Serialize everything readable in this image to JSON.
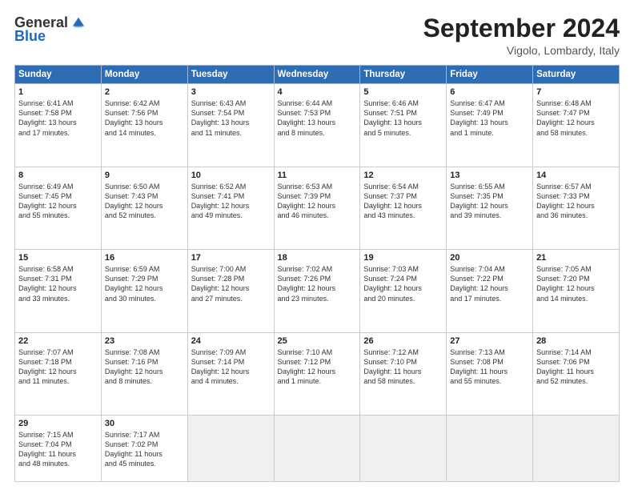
{
  "logo": {
    "general": "General",
    "blue": "Blue"
  },
  "title": "September 2024",
  "location": "Vigolo, Lombardy, Italy",
  "days_of_week": [
    "Sunday",
    "Monday",
    "Tuesday",
    "Wednesday",
    "Thursday",
    "Friday",
    "Saturday"
  ],
  "weeks": [
    [
      {
        "day": "1",
        "text": "Sunrise: 6:41 AM\nSunset: 7:58 PM\nDaylight: 13 hours\nand 17 minutes."
      },
      {
        "day": "2",
        "text": "Sunrise: 6:42 AM\nSunset: 7:56 PM\nDaylight: 13 hours\nand 14 minutes."
      },
      {
        "day": "3",
        "text": "Sunrise: 6:43 AM\nSunset: 7:54 PM\nDaylight: 13 hours\nand 11 minutes."
      },
      {
        "day": "4",
        "text": "Sunrise: 6:44 AM\nSunset: 7:53 PM\nDaylight: 13 hours\nand 8 minutes."
      },
      {
        "day": "5",
        "text": "Sunrise: 6:46 AM\nSunset: 7:51 PM\nDaylight: 13 hours\nand 5 minutes."
      },
      {
        "day": "6",
        "text": "Sunrise: 6:47 AM\nSunset: 7:49 PM\nDaylight: 13 hours\nand 1 minute."
      },
      {
        "day": "7",
        "text": "Sunrise: 6:48 AM\nSunset: 7:47 PM\nDaylight: 12 hours\nand 58 minutes."
      }
    ],
    [
      {
        "day": "8",
        "text": "Sunrise: 6:49 AM\nSunset: 7:45 PM\nDaylight: 12 hours\nand 55 minutes."
      },
      {
        "day": "9",
        "text": "Sunrise: 6:50 AM\nSunset: 7:43 PM\nDaylight: 12 hours\nand 52 minutes."
      },
      {
        "day": "10",
        "text": "Sunrise: 6:52 AM\nSunset: 7:41 PM\nDaylight: 12 hours\nand 49 minutes."
      },
      {
        "day": "11",
        "text": "Sunrise: 6:53 AM\nSunset: 7:39 PM\nDaylight: 12 hours\nand 46 minutes."
      },
      {
        "day": "12",
        "text": "Sunrise: 6:54 AM\nSunset: 7:37 PM\nDaylight: 12 hours\nand 43 minutes."
      },
      {
        "day": "13",
        "text": "Sunrise: 6:55 AM\nSunset: 7:35 PM\nDaylight: 12 hours\nand 39 minutes."
      },
      {
        "day": "14",
        "text": "Sunrise: 6:57 AM\nSunset: 7:33 PM\nDaylight: 12 hours\nand 36 minutes."
      }
    ],
    [
      {
        "day": "15",
        "text": "Sunrise: 6:58 AM\nSunset: 7:31 PM\nDaylight: 12 hours\nand 33 minutes."
      },
      {
        "day": "16",
        "text": "Sunrise: 6:59 AM\nSunset: 7:29 PM\nDaylight: 12 hours\nand 30 minutes."
      },
      {
        "day": "17",
        "text": "Sunrise: 7:00 AM\nSunset: 7:28 PM\nDaylight: 12 hours\nand 27 minutes."
      },
      {
        "day": "18",
        "text": "Sunrise: 7:02 AM\nSunset: 7:26 PM\nDaylight: 12 hours\nand 23 minutes."
      },
      {
        "day": "19",
        "text": "Sunrise: 7:03 AM\nSunset: 7:24 PM\nDaylight: 12 hours\nand 20 minutes."
      },
      {
        "day": "20",
        "text": "Sunrise: 7:04 AM\nSunset: 7:22 PM\nDaylight: 12 hours\nand 17 minutes."
      },
      {
        "day": "21",
        "text": "Sunrise: 7:05 AM\nSunset: 7:20 PM\nDaylight: 12 hours\nand 14 minutes."
      }
    ],
    [
      {
        "day": "22",
        "text": "Sunrise: 7:07 AM\nSunset: 7:18 PM\nDaylight: 12 hours\nand 11 minutes."
      },
      {
        "day": "23",
        "text": "Sunrise: 7:08 AM\nSunset: 7:16 PM\nDaylight: 12 hours\nand 8 minutes."
      },
      {
        "day": "24",
        "text": "Sunrise: 7:09 AM\nSunset: 7:14 PM\nDaylight: 12 hours\nand 4 minutes."
      },
      {
        "day": "25",
        "text": "Sunrise: 7:10 AM\nSunset: 7:12 PM\nDaylight: 12 hours\nand 1 minute."
      },
      {
        "day": "26",
        "text": "Sunrise: 7:12 AM\nSunset: 7:10 PM\nDaylight: 11 hours\nand 58 minutes."
      },
      {
        "day": "27",
        "text": "Sunrise: 7:13 AM\nSunset: 7:08 PM\nDaylight: 11 hours\nand 55 minutes."
      },
      {
        "day": "28",
        "text": "Sunrise: 7:14 AM\nSunset: 7:06 PM\nDaylight: 11 hours\nand 52 minutes."
      }
    ],
    [
      {
        "day": "29",
        "text": "Sunrise: 7:15 AM\nSunset: 7:04 PM\nDaylight: 11 hours\nand 48 minutes."
      },
      {
        "day": "30",
        "text": "Sunrise: 7:17 AM\nSunset: 7:02 PM\nDaylight: 11 hours\nand 45 minutes."
      },
      {
        "day": "",
        "text": ""
      },
      {
        "day": "",
        "text": ""
      },
      {
        "day": "",
        "text": ""
      },
      {
        "day": "",
        "text": ""
      },
      {
        "day": "",
        "text": ""
      }
    ]
  ]
}
